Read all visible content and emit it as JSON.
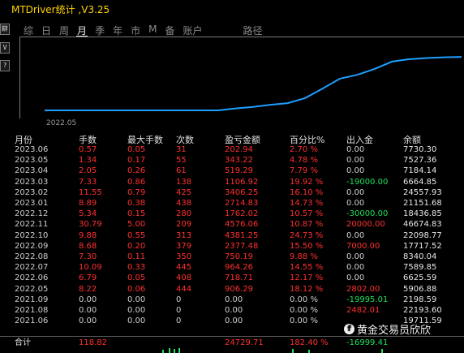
{
  "title": "MTDriver统计 ,V3.25",
  "side_buttons": [
    "辥",
    "V",
    "?"
  ],
  "menu": [
    {
      "label": "综"
    },
    {
      "label": "日"
    },
    {
      "label": "周"
    },
    {
      "label": "月",
      "active": true
    },
    {
      "label": "季"
    },
    {
      "label": "年"
    },
    {
      "label": "市"
    },
    {
      "label": "M"
    },
    {
      "label": "备"
    },
    {
      "label": "账户"
    },
    {
      "label": "路径"
    }
  ],
  "chart": {
    "x_tick": "2022.05",
    "line_color": "#1e9fff"
  },
  "chart_data": {
    "type": "line",
    "x": [
      "2021.06",
      "2021.07",
      "2021.08",
      "2021.09",
      "2021.10",
      "2021.11",
      "2021.12",
      "2022.01",
      "2022.02",
      "2022.03",
      "2022.04",
      "2022.05",
      "2022.06",
      "2022.07",
      "2022.08",
      "2022.09",
      "2022.10",
      "2022.11",
      "2022.12",
      "2023.01",
      "2023.02",
      "2023.03",
      "2023.04",
      "2023.05",
      "2023.06"
    ],
    "series": [
      {
        "values": [
          0,
          0,
          0,
          0,
          0,
          0,
          0,
          0,
          0,
          0,
          0,
          906,
          1625,
          2589,
          3340,
          5717,
          10098,
          14674,
          16436,
          19150,
          22556,
          23663,
          24182,
          24525,
          24729
        ]
      }
    ]
  },
  "table": {
    "headers": [
      "月份",
      "手数",
      "最大手数",
      "次数",
      "盈亏金额",
      "百分比%",
      "出入金",
      "余额"
    ],
    "rows": [
      [
        "2023.06",
        "0.57",
        "0.05",
        "31",
        "202.94",
        "2.70 %",
        "0.00",
        "7730.30"
      ],
      [
        "2023.05",
        "1.34",
        "0.17",
        "55",
        "343.22",
        "4.78 %",
        "0.00",
        "7527.36"
      ],
      [
        "2023.04",
        "2.05",
        "0.26",
        "61",
        "519.29",
        "7.79 %",
        "0.00",
        "7184.14"
      ],
      [
        "2023.03",
        "7.33",
        "0.86",
        "138",
        "1106.92",
        "19.92 %",
        "-19000.00",
        "6664.85"
      ],
      [
        "2023.02",
        "11.55",
        "0.79",
        "425",
        "3406.25",
        "16.10 %",
        "0.00",
        "24557.93"
      ],
      [
        "2023.01",
        "8.89",
        "0.38",
        "438",
        "2714.83",
        "14.73 %",
        "0.00",
        "21151.68"
      ],
      [
        "2022.12",
        "5.34",
        "0.15",
        "280",
        "1762.02",
        "10.57 %",
        "-30000.00",
        "18436.85"
      ],
      [
        "2022.11",
        "30.79",
        "5.00",
        "209",
        "4576.06",
        "10.87 %",
        "20000.00",
        "46674.83"
      ],
      [
        "2022.10",
        "9.88",
        "0.55",
        "313",
        "4381.25",
        "24.73 %",
        "0.00",
        "22098.77"
      ],
      [
        "2022.09",
        "8.68",
        "0.20",
        "379",
        "2377.48",
        "15.50 %",
        "7000.00",
        "17717.52"
      ],
      [
        "2022.08",
        "7.30",
        "0.11",
        "350",
        "750.19",
        "9.88 %",
        "0.00",
        "8340.04"
      ],
      [
        "2022.07",
        "10.09",
        "0.33",
        "445",
        "964.26",
        "14.55 %",
        "0.00",
        "7589.85"
      ],
      [
        "2022.06",
        "6.79",
        "0.05",
        "408",
        "718.71",
        "12.17 %",
        "0.00",
        "6625.59"
      ],
      [
        "2022.05",
        "8.22",
        "0.06",
        "444",
        "906.29",
        "18.12 %",
        "2802.00",
        "5906.88"
      ],
      [
        "2021.09",
        "0.00",
        "0.00",
        "0",
        "0.00",
        "0.00 %",
        "-19995.01",
        "2198.59"
      ],
      [
        "2021.08",
        "0.00",
        "0.00",
        "0",
        "0.00",
        "0.00 %",
        "2482.01",
        "22193.60"
      ],
      [
        "2021.06",
        "0.00",
        "0.00",
        "0",
        "0.00",
        "0.00 %",
        "",
        "19711.59"
      ]
    ],
    "total": [
      "合计",
      "118.82",
      "",
      "",
      "24729.71",
      "182.40 %",
      "-16999.41",
      ""
    ]
  },
  "watermark": {
    "icon": "f",
    "text": "黄金交易员欣欣"
  }
}
